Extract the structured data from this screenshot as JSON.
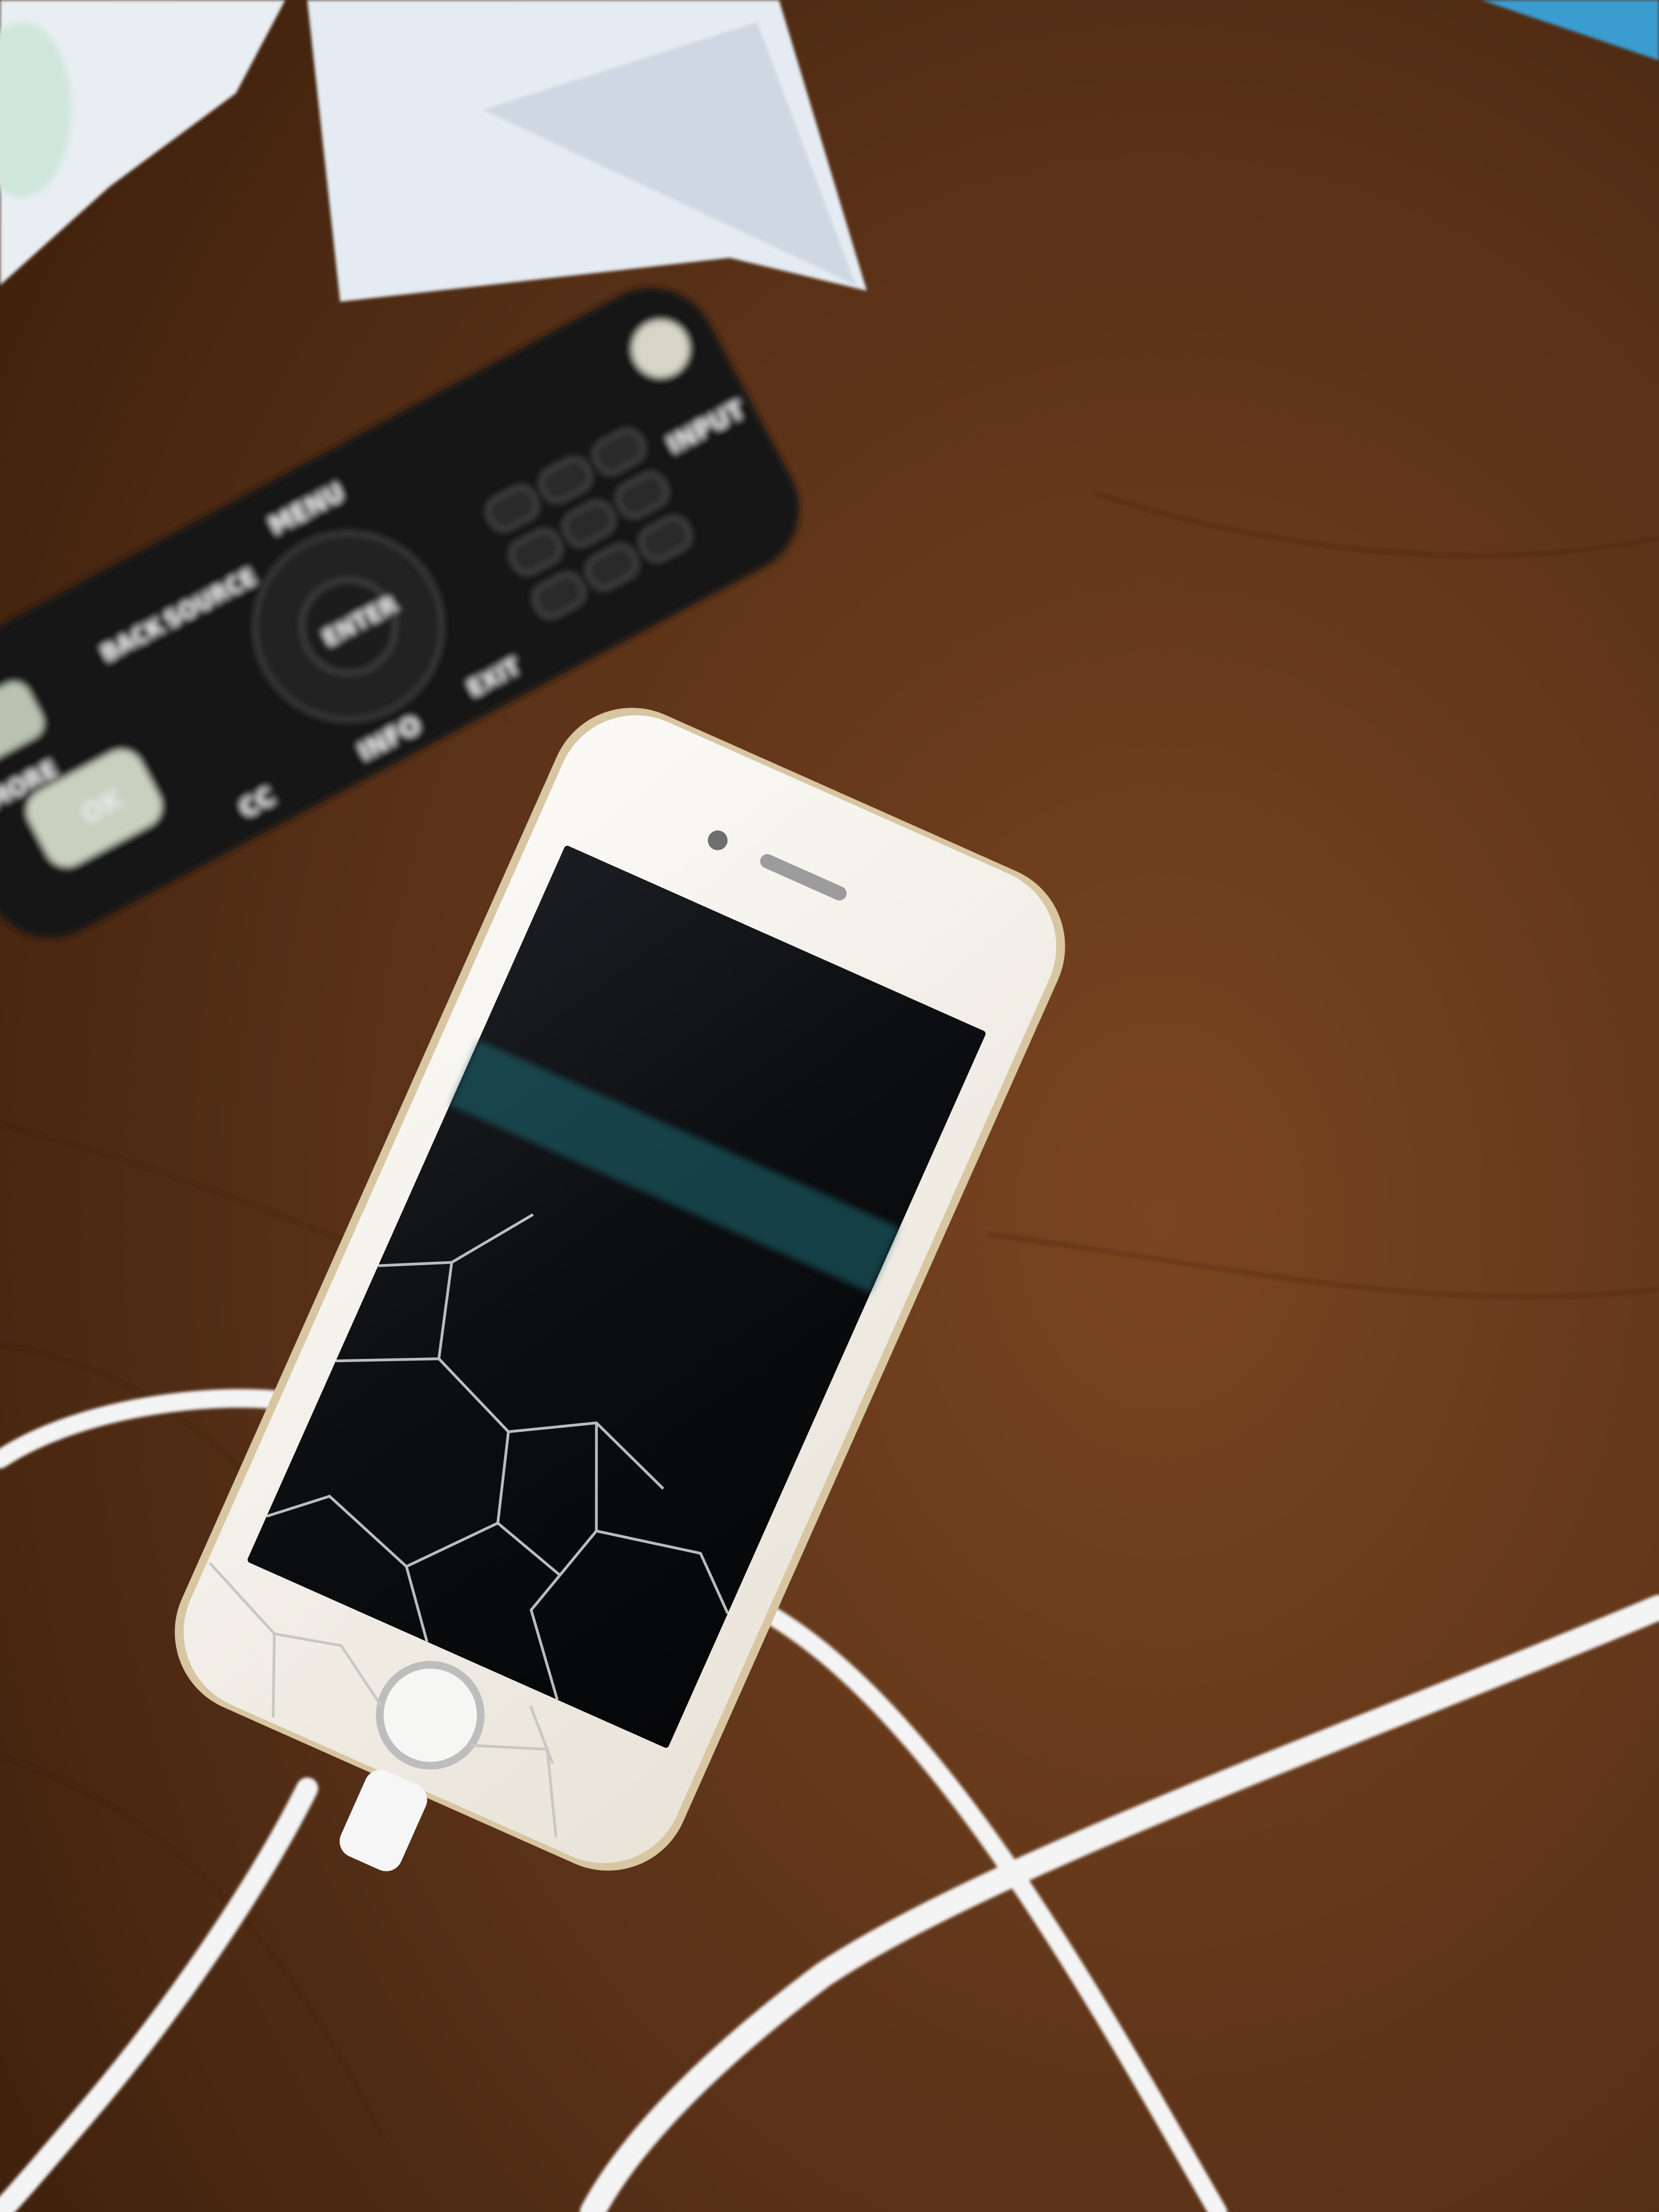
{
  "scene": {
    "subject": "cracked-iphone-charging-on-wooden-table",
    "colors": {
      "table": "#5a3218",
      "table_dark": "#3e200c",
      "phone_body": "#f2efe9",
      "phone_gold_edge": "#d8c6a2",
      "screen": "#0d0f12",
      "remote": "#141414",
      "cable": "#f4f4f4",
      "paper": "#e6ecf2"
    }
  },
  "remote": {
    "buttons": {
      "menu": "MENU",
      "enter": "ENTER",
      "source": "SOURCE",
      "info": "INFO",
      "more": "MORE",
      "ok": "OK",
      "input": "INPUT",
      "cc": "CC",
      "exit": "EXIT",
      "back": "BACK"
    }
  }
}
